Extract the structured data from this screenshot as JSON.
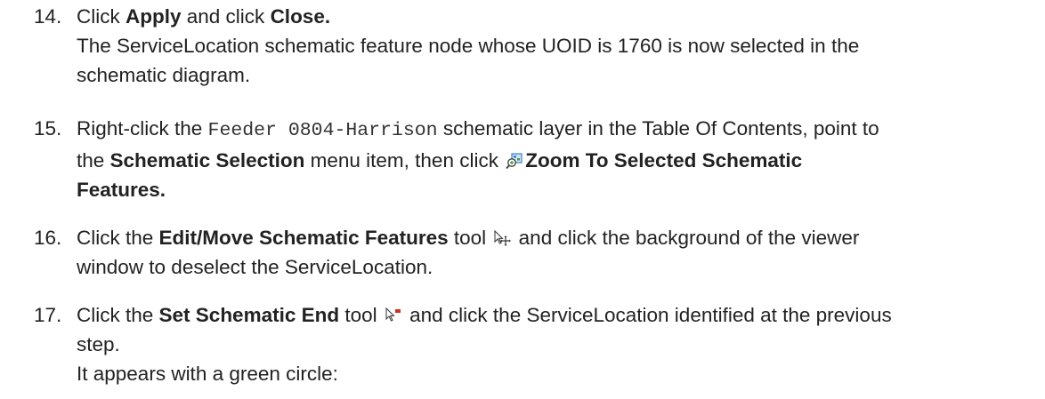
{
  "steps": [
    {
      "number": "14.",
      "line1": {
        "t1": "Click ",
        "b1": "Apply",
        "t2": " and click ",
        "b2": "Close."
      },
      "line2": "The ServiceLocation schematic feature node whose UOID is 1760 is now selected in the",
      "line3": "schematic diagram."
    },
    {
      "number": "15.",
      "line1": {
        "t1": "Right-click the ",
        "code": "Feeder 0804-Harrison",
        "t2": " schematic layer in the Table Of Contents, point to"
      },
      "line2": {
        "t1": "the ",
        "b1": "Schematic Selection",
        "t2": " menu item, then click ",
        "icon": "zoom-to-selected-icon",
        "b2": "Zoom To Selected Schematic"
      },
      "line3": {
        "b1": "Features."
      }
    },
    {
      "number": "16.",
      "line1": {
        "t1": "Click the ",
        "b1": "Edit/Move Schematic Features",
        "t2": " tool ",
        "icon": "edit-move-tool-icon",
        "t3": " and click the background of the viewer"
      },
      "line2": "window to deselect the ServiceLocation."
    },
    {
      "number": "17.",
      "line1": {
        "t1": "Click the ",
        "b1": "Set Schematic End",
        "t2": " tool ",
        "icon": "set-schematic-end-tool-icon",
        "t3": " and click the ServiceLocation identified at the previous"
      },
      "line2": "step.",
      "line3": "It appears with a green circle:"
    }
  ],
  "colors": {
    "text": "#222222",
    "icon_blue": "#3a7fc4",
    "icon_green": "#4a9a3a",
    "icon_red": "#d0301c"
  }
}
